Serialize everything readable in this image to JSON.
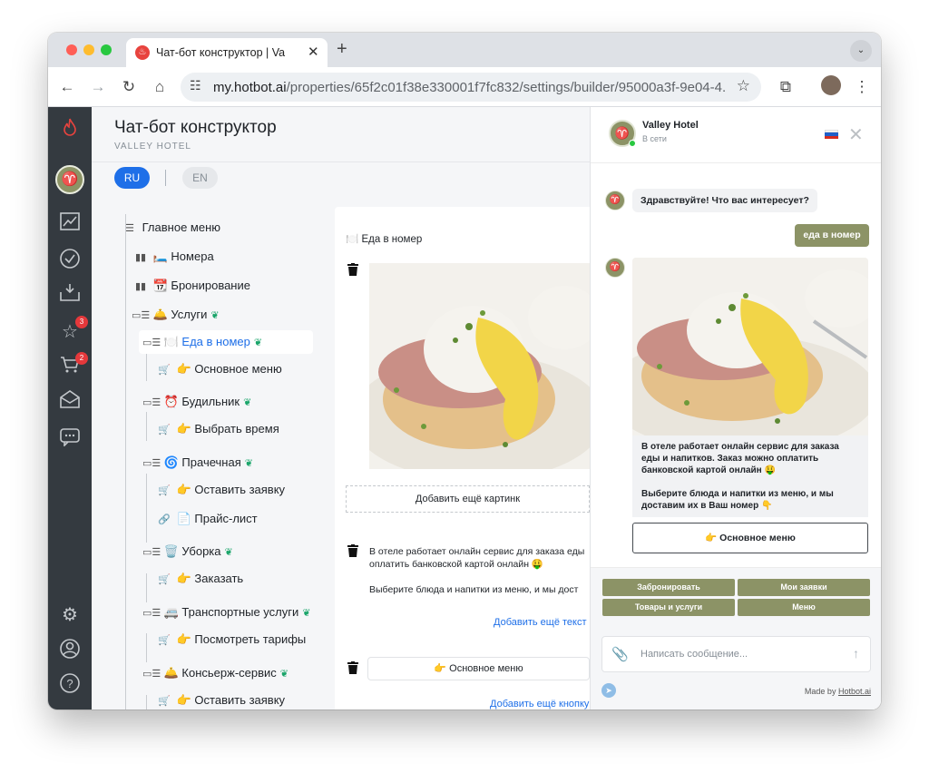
{
  "browser": {
    "tab_title": "Чат-бот конструктор | Va",
    "url_host": "my.hotbot.ai",
    "url_path": "/properties/65f2c01f38e330001f7fc832/settings/builder/95000a3f-9e04-4..."
  },
  "page": {
    "title": "Чат-бот конструктор",
    "subtitle": "VALLEY HOTEL",
    "lang_ru": "RU",
    "lang_en": "EN"
  },
  "nav_badges": {
    "reviews": "3",
    "cart": "2"
  },
  "tree": {
    "root": "Главное меню",
    "items": [
      {
        "label": "🛏️ Номера"
      },
      {
        "label": "📆 Бронирование"
      },
      {
        "label": "🛎️ Услуги"
      },
      {
        "label": "🍽️ Еда в номер"
      },
      {
        "label": "👉 Основное меню"
      },
      {
        "label": "⏰ Будильник"
      },
      {
        "label": "👉 Выбрать время"
      },
      {
        "label": "🌀 Прачечная"
      },
      {
        "label": "👉 Оставить заявку"
      },
      {
        "label": "📄 Прайс-лист"
      },
      {
        "label": "🗑️ Уборка"
      },
      {
        "label": "👉 Заказать"
      },
      {
        "label": "🚐 Транспортные услуги"
      },
      {
        "label": "👉 Посмотреть тарифы"
      },
      {
        "label": "🛎️ Консьерж-сервис"
      },
      {
        "label": "👉 Оставить заявку"
      }
    ]
  },
  "editor": {
    "heading": "🍽️ Еда в номер",
    "add_image": "Добавить ещё картинк",
    "text_line1": "В отеле работает онлайн сервис для заказа еды",
    "text_line2": "оплатить банковской картой онлайн 🤑",
    "text_line3": "Выберите блюда и напитки из меню, и мы дост",
    "add_text": "Добавить ещё текст",
    "button_label": "👉 Основное меню",
    "add_button": "Добавить ещё кнопку"
  },
  "chat": {
    "name": "Valley Hotel",
    "status": "В сети",
    "greeting": "Здравствуйте! Что вас интересует?",
    "user_msg": "еда в номер",
    "bot_text_p1": "В отеле работает онлайн сервис для заказа еды и напитков. Заказ можно оплатить банковской картой онлайн 🤑",
    "bot_text_p2": "Выберите блюда и напитки из меню, и мы доставим их в Ваш номер 👇",
    "menu_button": "👉 Основное меню",
    "quick_replies": [
      "Забронировать",
      "Мои заявки",
      "Товары и услуги",
      "Меню"
    ],
    "input_placeholder": "Написать сообщение...",
    "made_by": "Made by",
    "made_by_link": "Hotbot.ai"
  },
  "colors": {
    "accent_blue": "#1e6fe8",
    "olive": "#8c9366",
    "sidebar": "#343a40"
  },
  "icons": [
    "flame-icon",
    "brand-logo-icon",
    "chart-icon",
    "check-circle-icon",
    "inbox-icon",
    "star-icon",
    "cart-icon",
    "envelope-icon",
    "chat-icon",
    "gear-icon",
    "user-icon",
    "help-icon",
    "trash-icon",
    "paperclip-icon",
    "send-icon",
    "telegram-icon",
    "close-icon"
  ]
}
